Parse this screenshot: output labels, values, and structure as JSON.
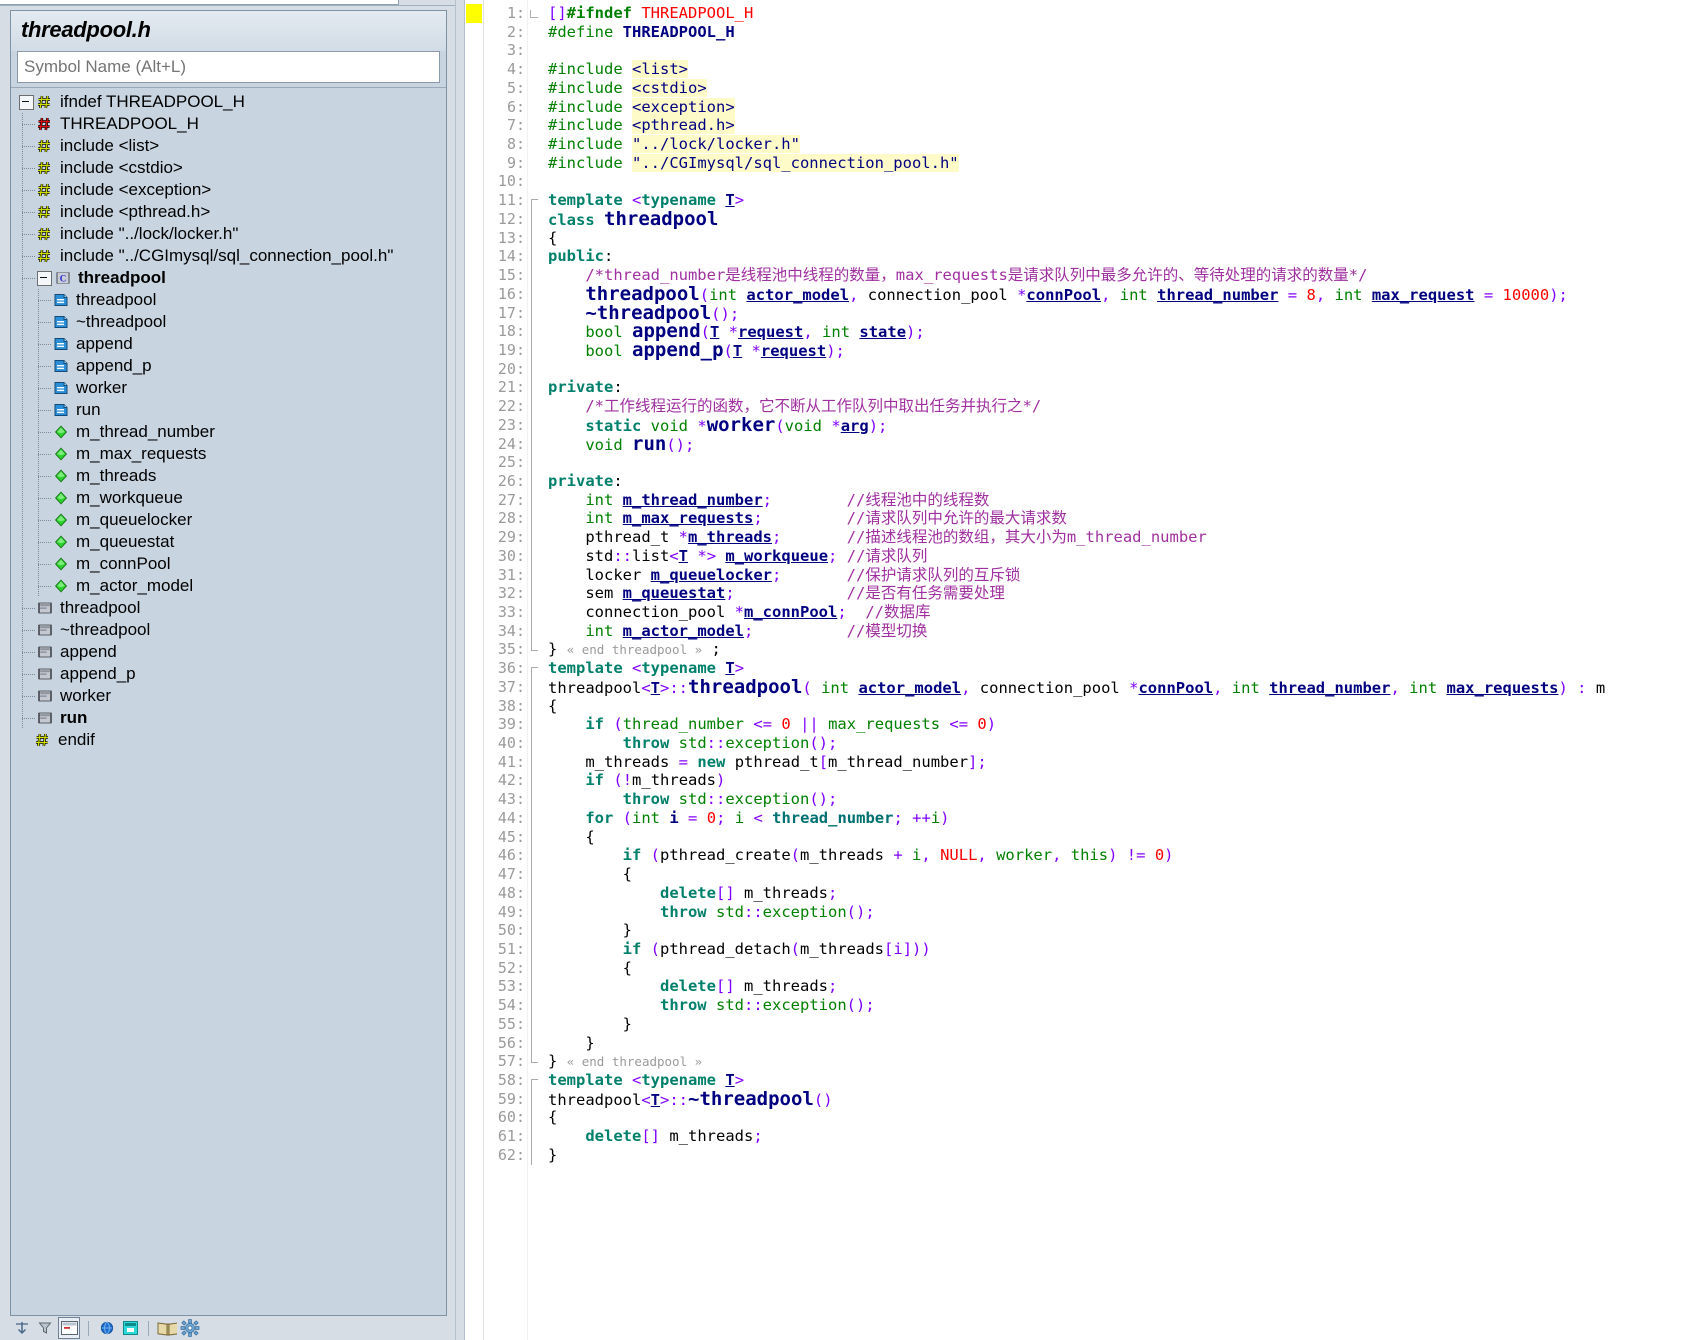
{
  "window": {
    "file_title": "threadpool.h"
  },
  "sidebar": {
    "title": "threadpool.h",
    "search": {
      "placeholder": "Symbol Name (Alt+L)",
      "value": ""
    },
    "tree": [
      {
        "label": "ifndef THREADPOOL_H",
        "icon": "preprocessor-icon",
        "depth": 0,
        "twisty": "minus",
        "bold": false
      },
      {
        "label": "THREADPOOL_H",
        "icon": "macro-icon",
        "depth": 1,
        "twisty": "none",
        "bold": false
      },
      {
        "label": "include <list>",
        "icon": "preprocessor-icon",
        "depth": 1,
        "twisty": "none",
        "bold": false
      },
      {
        "label": "include <cstdio>",
        "icon": "preprocessor-icon",
        "depth": 1,
        "twisty": "none",
        "bold": false
      },
      {
        "label": "include <exception>",
        "icon": "preprocessor-icon",
        "depth": 1,
        "twisty": "none",
        "bold": false
      },
      {
        "label": "include <pthread.h>",
        "icon": "preprocessor-icon",
        "depth": 1,
        "twisty": "none",
        "bold": false
      },
      {
        "label": "include \"../lock/locker.h\"",
        "icon": "preprocessor-icon",
        "depth": 1,
        "twisty": "none",
        "bold": false
      },
      {
        "label": "include \"../CGImysql/sql_connection_pool.h\"",
        "icon": "preprocessor-icon",
        "depth": 1,
        "twisty": "none",
        "bold": false
      },
      {
        "label": "threadpool",
        "icon": "class-icon",
        "depth": 1,
        "twisty": "minus",
        "bold": true
      },
      {
        "label": "threadpool",
        "icon": "method-icon",
        "depth": 2,
        "twisty": "none",
        "bold": false
      },
      {
        "label": "~threadpool",
        "icon": "method-icon",
        "depth": 2,
        "twisty": "none",
        "bold": false
      },
      {
        "label": "append",
        "icon": "method-icon",
        "depth": 2,
        "twisty": "none",
        "bold": false
      },
      {
        "label": "append_p",
        "icon": "method-icon",
        "depth": 2,
        "twisty": "none",
        "bold": false
      },
      {
        "label": "worker",
        "icon": "method-icon",
        "depth": 2,
        "twisty": "none",
        "bold": false
      },
      {
        "label": "run",
        "icon": "method-icon",
        "depth": 2,
        "twisty": "none",
        "bold": false
      },
      {
        "label": "m_thread_number",
        "icon": "member-variable-icon",
        "depth": 2,
        "twisty": "none",
        "bold": false
      },
      {
        "label": "m_max_requests",
        "icon": "member-variable-icon",
        "depth": 2,
        "twisty": "none",
        "bold": false
      },
      {
        "label": "m_threads",
        "icon": "member-variable-icon",
        "depth": 2,
        "twisty": "none",
        "bold": false
      },
      {
        "label": "m_workqueue",
        "icon": "member-variable-icon",
        "depth": 2,
        "twisty": "none",
        "bold": false
      },
      {
        "label": "m_queuelocker",
        "icon": "member-variable-icon",
        "depth": 2,
        "twisty": "none",
        "bold": false
      },
      {
        "label": "m_queuestat",
        "icon": "member-variable-icon",
        "depth": 2,
        "twisty": "none",
        "bold": false
      },
      {
        "label": "m_connPool",
        "icon": "member-variable-icon",
        "depth": 2,
        "twisty": "none",
        "bold": false
      },
      {
        "label": "m_actor_model",
        "icon": "member-variable-icon",
        "depth": 2,
        "twisty": "none",
        "bold": false
      },
      {
        "label": "threadpool",
        "icon": "function-definition-icon",
        "depth": 1,
        "twisty": "none",
        "bold": false
      },
      {
        "label": "~threadpool",
        "icon": "function-definition-icon",
        "depth": 1,
        "twisty": "none",
        "bold": false
      },
      {
        "label": "append",
        "icon": "function-definition-icon",
        "depth": 1,
        "twisty": "none",
        "bold": false
      },
      {
        "label": "append_p",
        "icon": "function-definition-icon",
        "depth": 1,
        "twisty": "none",
        "bold": false
      },
      {
        "label": "worker",
        "icon": "function-definition-icon",
        "depth": 1,
        "twisty": "none",
        "bold": false
      },
      {
        "label": "run",
        "icon": "function-definition-icon",
        "depth": 1,
        "twisty": "none",
        "bold": true
      },
      {
        "label": "endif",
        "icon": "preprocessor-icon",
        "depth": 0,
        "twisty": "none",
        "bold": false
      }
    ],
    "toolbar": [
      {
        "name": "sort-icon",
        "label": "Sort"
      },
      {
        "name": "filter-icon",
        "label": "Filter"
      },
      {
        "name": "panel-layout-icon",
        "label": "Panel Layout"
      },
      {
        "name": "globe-icon",
        "label": "Globe"
      },
      {
        "name": "window-icon",
        "label": "Window"
      },
      {
        "name": "book-icon",
        "label": "Book"
      },
      {
        "name": "gear-icon",
        "label": "Settings"
      }
    ]
  },
  "editor": {
    "bookmark_line": 1,
    "colors": {
      "background": "#ffffff",
      "line_number": "#9a9a9a",
      "keyword": "#00806b",
      "type": "#008000",
      "comment": "#a030a0",
      "string_highlight": "#fffbc8",
      "class_name": "#000080",
      "number": "#ff0000",
      "operator": "#8000ff",
      "bookmark": "#ffff00"
    },
    "line_numbers": [
      1,
      2,
      3,
      4,
      5,
      6,
      7,
      8,
      9,
      10,
      11,
      12,
      13,
      14,
      15,
      16,
      17,
      18,
      19,
      20,
      21,
      22,
      23,
      24,
      25,
      26,
      27,
      28,
      29,
      30,
      31,
      32,
      33,
      34,
      35,
      36,
      37,
      38,
      39,
      40,
      41,
      42,
      43,
      44,
      45,
      46,
      47,
      48,
      49,
      50,
      51,
      52,
      53,
      54,
      55,
      56,
      57,
      58,
      59,
      60,
      61,
      62
    ],
    "lines": {
      "1": "[]#ifndef THREADPOOL_H",
      "2": "#define THREADPOOL_H",
      "3": "",
      "4": "#include <list>",
      "5": "#include <cstdio>",
      "6": "#include <exception>",
      "7": "#include <pthread.h>",
      "8": "#include \"../lock/locker.h\"",
      "9": "#include \"../CGImysql/sql_connection_pool.h\"",
      "10": "",
      "11": "template <typename T>",
      "12": "class threadpool",
      "13": "{",
      "14": "public:",
      "15": "    /*thread_number是线程池中线程的数量，max_requests是请求队列中最多允许的、等待处理的请求的数量*/",
      "16": "    threadpool(int actor_model, connection_pool *connPool, int thread_number = 8, int max_request = 10000);",
      "17": "    ~threadpool();",
      "18": "    bool append(T *request, int state);",
      "19": "    bool append_p(T *request);",
      "20": "",
      "21": "private:",
      "22": "    /*工作线程运行的函数，它不断从工作队列中取出任务并执行之*/",
      "23": "    static void *worker(void *arg);",
      "24": "    void run();",
      "25": "",
      "26": "private:",
      "27": "    int m_thread_number;        //线程池中的线程数",
      "28": "    int m_max_requests;         //请求队列中允许的最大请求数",
      "29": "    pthread_t *m_threads;       //描述线程池的数组，其大小为m_thread_number",
      "30": "    std::list<T *> m_workqueue; //请求队列",
      "31": "    locker m_queuelocker;       //保护请求队列的互斥锁",
      "32": "    sem m_queuestat;            //是否有任务需要处理",
      "33": "    connection_pool *m_connPool;  //数据库",
      "34": "    int m_actor_model;          //模型切换",
      "35": "} « end threadpool » ;",
      "36": "template <typename T>",
      "37": "threadpool<T>::threadpool( int actor_model, connection_pool *connPool, int thread_number, int max_requests) : m",
      "38": "{",
      "39": "    if (thread_number <= 0 || max_requests <= 0)",
      "40": "        throw std::exception();",
      "41": "    m_threads = new pthread_t[m_thread_number];",
      "42": "    if (!m_threads)",
      "43": "        throw std::exception();",
      "44": "    for (int i = 0; i < thread_number; ++i)",
      "45": "    {",
      "46": "        if (pthread_create(m_threads + i, NULL, worker, this) != 0)",
      "47": "        {",
      "48": "            delete[] m_threads;",
      "49": "            throw std::exception();",
      "50": "        }",
      "51": "        if (pthread_detach(m_threads[i]))",
      "52": "        {",
      "53": "            delete[] m_threads;",
      "54": "            throw std::exception();",
      "55": "        }",
      "56": "    }",
      "57": "} « end threadpool »",
      "58": "template <typename T>",
      "59": "threadpool<T>::~threadpool()",
      "60": "{",
      "61": "    delete[] m_threads;",
      "62": "}"
    },
    "fold_markers": [
      "« end threadpool » ;",
      "« end threadpool »"
    ]
  }
}
